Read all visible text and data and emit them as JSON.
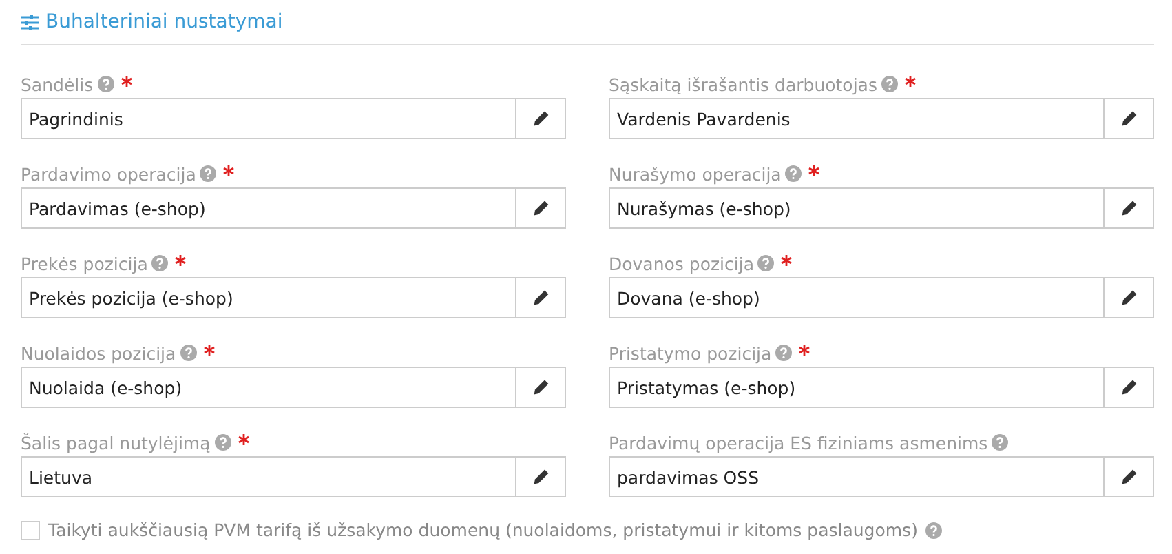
{
  "section": {
    "title": "Buhalteriniai nustatymai"
  },
  "fields": [
    {
      "label": "Sandėlis",
      "required": true,
      "value": "Pagrindinis"
    },
    {
      "label": "Sąskaitą išrašantis darbuotojas",
      "required": true,
      "value": "Vardenis Pavardenis"
    },
    {
      "label": "Pardavimo operacija",
      "required": true,
      "value": "Pardavimas (e-shop)"
    },
    {
      "label": "Nurašymo operacija",
      "required": true,
      "value": "Nurašymas (e-shop)"
    },
    {
      "label": "Prekės pozicija",
      "required": true,
      "value": "Prekės pozicija (e-shop)"
    },
    {
      "label": "Dovanos pozicija",
      "required": true,
      "value": "Dovana (e-shop)"
    },
    {
      "label": "Nuolaidos pozicija",
      "required": true,
      "value": "Nuolaida (e-shop)"
    },
    {
      "label": "Pristatymo pozicija",
      "required": true,
      "value": "Pristatymas (e-shop)"
    },
    {
      "label": "Šalis pagal nutylėjimą",
      "required": true,
      "value": "Lietuva"
    },
    {
      "label": "Pardavimų operacija ES fiziniams asmenims",
      "required": false,
      "value": "pardavimas OSS"
    }
  ],
  "checkbox": {
    "label": "Taikyti aukščiausią PVM tarifą iš užsakymo duomenų (nuolaidoms, pristatymui ir kitoms paslaugoms)",
    "checked": false
  }
}
